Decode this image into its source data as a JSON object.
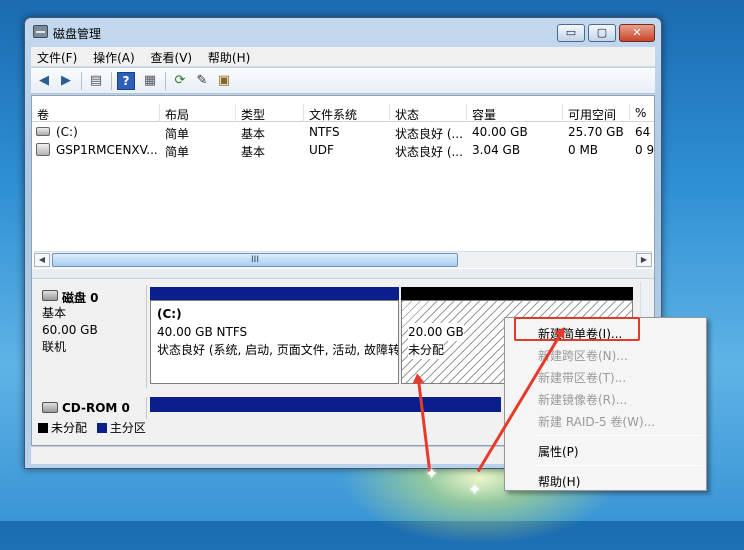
{
  "window": {
    "title": "磁盘管理",
    "minimize_glyph": "▭",
    "maximize_glyph": "▢",
    "close_glyph": "✕"
  },
  "menu": [
    "文件(F)",
    "操作(A)",
    "查看(V)",
    "帮助(H)"
  ],
  "toolbar": {
    "icons": [
      "back-arrow-icon",
      "forward-arrow-icon",
      "console-tree-icon",
      "help-icon",
      "properties-icon",
      "refresh-icon",
      "settings-icon",
      "disk-icon"
    ],
    "help_glyph": "?"
  },
  "volume_table": {
    "columns": [
      "卷",
      "布局",
      "类型",
      "文件系统",
      "状态",
      "容量",
      "可用空间",
      "%"
    ],
    "rows": [
      {
        "volume": "(C:)",
        "layout": "简单",
        "type": "基本",
        "fs": "NTFS",
        "status": "状态良好 (...",
        "capacity": "40.00 GB",
        "free": "25.70 GB",
        "pct": "64"
      },
      {
        "volume": "GSP1RMCENXV...",
        "layout": "简单",
        "type": "基本",
        "fs": "UDF",
        "status": "状态良好 (...",
        "capacity": "3.04 GB",
        "free": "0 MB",
        "pct": "0 9"
      }
    ],
    "scroll_thumb_glyph": "III"
  },
  "disks": [
    {
      "name": "磁盘 0",
      "kind": "基本",
      "size": "60.00 GB",
      "state": "联机",
      "partitions": [
        {
          "label": "(C:)",
          "size_fs": "40.00 GB NTFS",
          "status": "状态良好 (系统, 启动, 页面文件, 活动, 故障转储, 主分区)"
        },
        {
          "label": "",
          "size_fs": "20.00 GB",
          "status": "未分配"
        }
      ]
    },
    {
      "name": "CD-ROM 0"
    }
  ],
  "legend": [
    {
      "label": "未分配",
      "color": "#000000"
    },
    {
      "label": "主分区",
      "color": "#0a1e8c"
    }
  ],
  "context_menu": [
    {
      "label": "新建简单卷(I)...",
      "enabled": true
    },
    {
      "label": "新建跨区卷(N)...",
      "enabled": false
    },
    {
      "label": "新建带区卷(T)...",
      "enabled": false
    },
    {
      "label": "新建镜像卷(R)...",
      "enabled": false
    },
    {
      "label": "新建 RAID-5 卷(W)...",
      "enabled": false
    },
    {
      "label": "属性(P)",
      "enabled": true
    },
    {
      "label": "帮助(H)",
      "enabled": true
    }
  ],
  "colors": {
    "primary_partition": "#0a1e8c",
    "unallocated": "#000000",
    "annotation": "#e23a2a"
  }
}
